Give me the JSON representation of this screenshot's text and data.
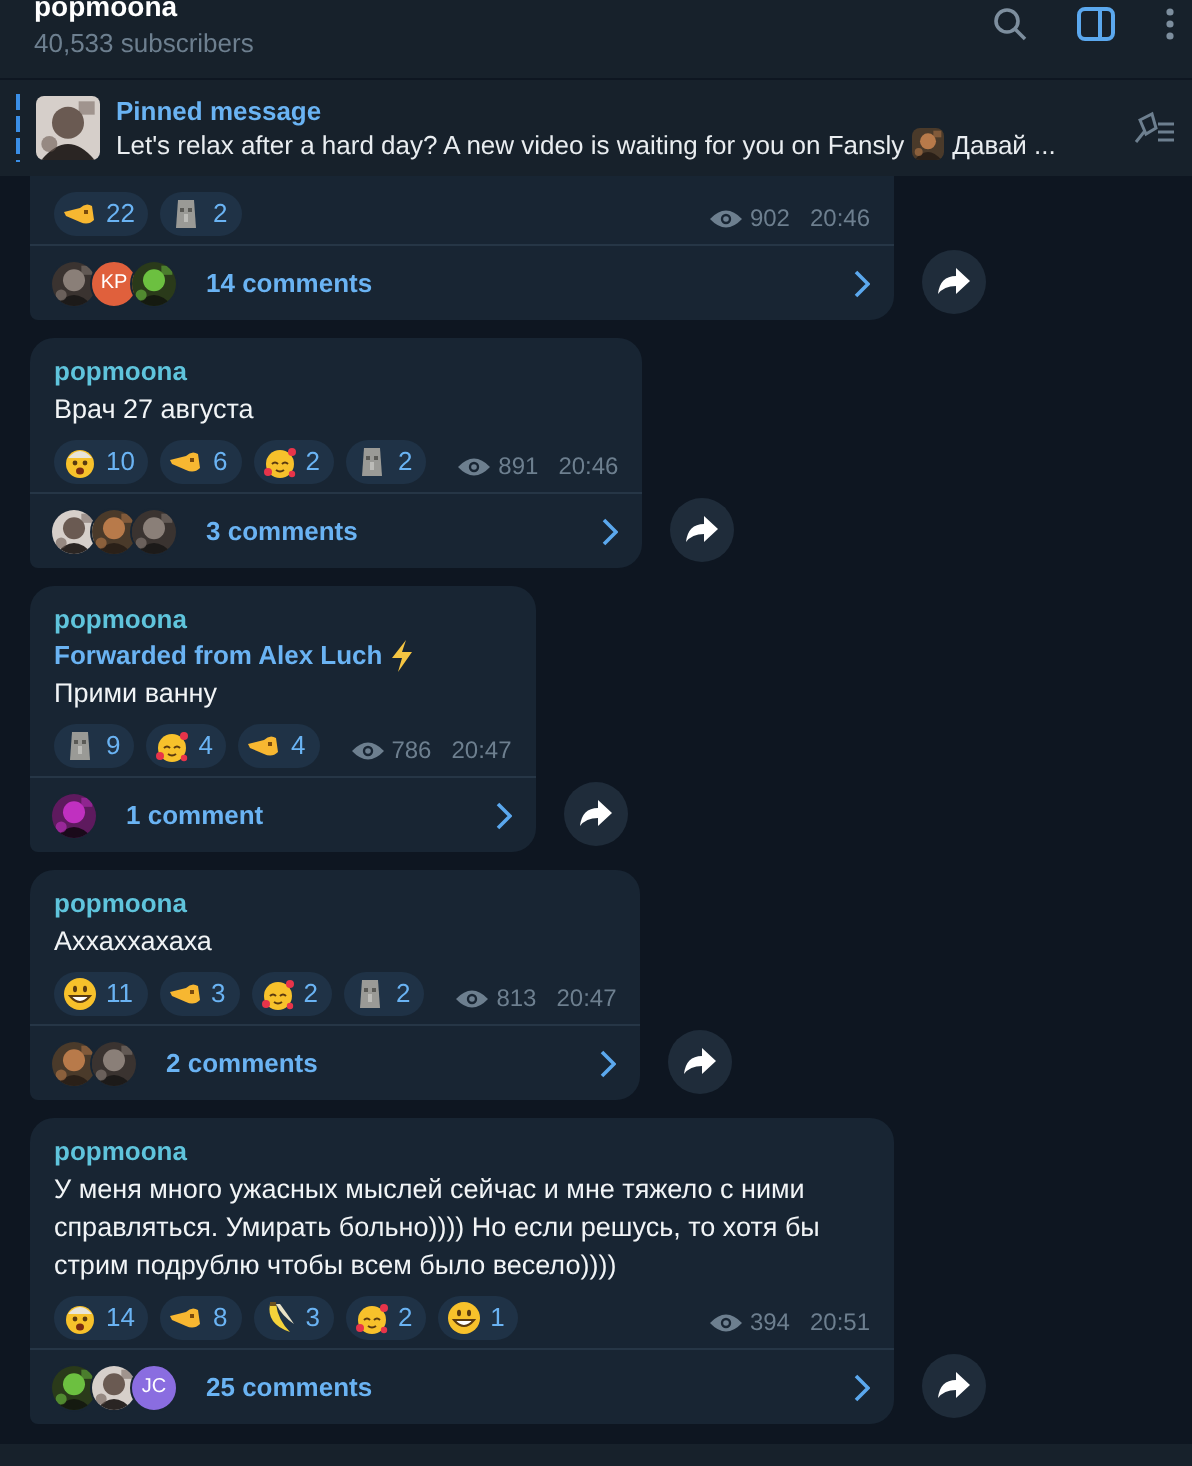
{
  "header": {
    "title": "popmoona",
    "subtitle": "40,533 subscribers"
  },
  "pinned": {
    "title": "Pinned message",
    "text": "Let's relax after a hard day? A new video is waiting for you on Fansly",
    "text_after": "Давай ..."
  },
  "messages": [
    {
      "reactions": [
        {
          "kind": "point",
          "count": "22"
        },
        {
          "kind": "moai",
          "count": "2"
        }
      ],
      "views": "902",
      "time": "20:46",
      "commenters": [
        {
          "kind": "picture"
        },
        {
          "kind": "initials",
          "initials": "KP",
          "color": "#e0603c"
        },
        {
          "kind": "picture"
        }
      ],
      "comments": "14 comments"
    },
    {
      "author": "popmoona",
      "text": "Врач 27 августа",
      "reactions": [
        {
          "kind": "shocked",
          "count": "10"
        },
        {
          "kind": "point",
          "count": "6"
        },
        {
          "kind": "love",
          "count": "2"
        },
        {
          "kind": "moai",
          "count": "2"
        }
      ],
      "views": "891",
      "time": "20:46",
      "commenters": [
        {
          "kind": "picture"
        },
        {
          "kind": "picture"
        },
        {
          "kind": "picture"
        }
      ],
      "comments": "3 comments"
    },
    {
      "author": "popmoona",
      "forwarded": {
        "text": "Forwarded from Alex Luch",
        "kind": "lightning"
      },
      "text": "Прими ванну",
      "reactions": [
        {
          "kind": "moai",
          "count": "9"
        },
        {
          "kind": "love",
          "count": "4"
        },
        {
          "kind": "point",
          "count": "4"
        }
      ],
      "views": "786",
      "time": "20:47",
      "commenters": [
        {
          "kind": "picture"
        }
      ],
      "comments": "1 comment"
    },
    {
      "author": "popmoona",
      "text": "Аххаххахаха",
      "reactions": [
        {
          "kind": "grin",
          "count": "11"
        },
        {
          "kind": "point",
          "count": "3"
        },
        {
          "kind": "love",
          "count": "2"
        },
        {
          "kind": "moai",
          "count": "2"
        }
      ],
      "views": "813",
      "time": "20:47",
      "commenters": [
        {
          "kind": "picture"
        },
        {
          "kind": "picture"
        }
      ],
      "comments": "2 comments"
    },
    {
      "author": "popmoona",
      "text": "У меня много ужасных мыслей сейчас и мне тяжело с ними справляться. Умирать больно)))) Но если решусь, то хотя бы стрим подрублю чтобы всем было весело))))",
      "reactions": [
        {
          "kind": "shocked",
          "count": "14"
        },
        {
          "kind": "point",
          "count": "8"
        },
        {
          "kind": "banana",
          "count": "3"
        },
        {
          "kind": "love",
          "count": "2"
        },
        {
          "kind": "grin",
          "count": "1"
        }
      ],
      "views": "394",
      "time": "20:51",
      "commenters": [
        {
          "kind": "picture"
        },
        {
          "kind": "picture"
        },
        {
          "kind": "initials",
          "initials": "JC",
          "color": "#8a6de0"
        }
      ],
      "comments": "25 comments"
    }
  ]
}
